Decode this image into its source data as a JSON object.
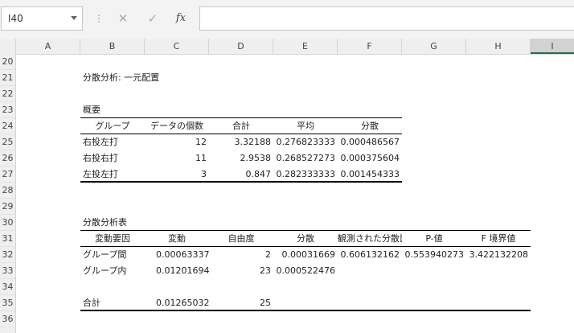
{
  "name_box": {
    "value": "I40"
  },
  "formula_bar": {
    "separator": "⋮",
    "cancel_glyph": "✕",
    "enter_glyph": "✓",
    "fx_label": "fx",
    "value": ""
  },
  "columns": [
    "A",
    "B",
    "C",
    "D",
    "E",
    "F",
    "G",
    "H",
    "I"
  ],
  "rows": [
    "20",
    "21",
    "22",
    "23",
    "24",
    "25",
    "26",
    "27",
    "28",
    "29",
    "30",
    "31",
    "32",
    "33",
    "34",
    "35",
    "36"
  ],
  "sheet": {
    "title": "分散分析: 一元配置",
    "summary_label": "概要",
    "summary_headers": [
      "グループ",
      "データの個数",
      "合計",
      "平均",
      "分散"
    ],
    "summary_rows": [
      [
        "右投左打",
        "12",
        "3.32188",
        "0.276823333",
        "0.000486567"
      ],
      [
        "右投右打",
        "11",
        "2.9538",
        "0.268527273",
        "0.000375604"
      ],
      [
        "左投左打",
        "3",
        "0.847",
        "0.282333333",
        "0.001454333"
      ]
    ],
    "anova_label": "分散分析表",
    "anova_headers": [
      "変動要因",
      "変動",
      "自由度",
      "分散",
      "観測された分散比",
      "P-値",
      "F 境界値"
    ],
    "anova_rows": [
      [
        "グループ間",
        "0.000633379",
        "2",
        "0.00031669",
        "0.606132162",
        "0.553940273",
        "3.422132208"
      ],
      [
        "グループ内",
        "0.012016948",
        "23",
        "0.000522476",
        "",
        "",
        ""
      ]
    ],
    "anova_total": [
      "合計",
      "0.012650327",
      "25"
    ]
  }
}
